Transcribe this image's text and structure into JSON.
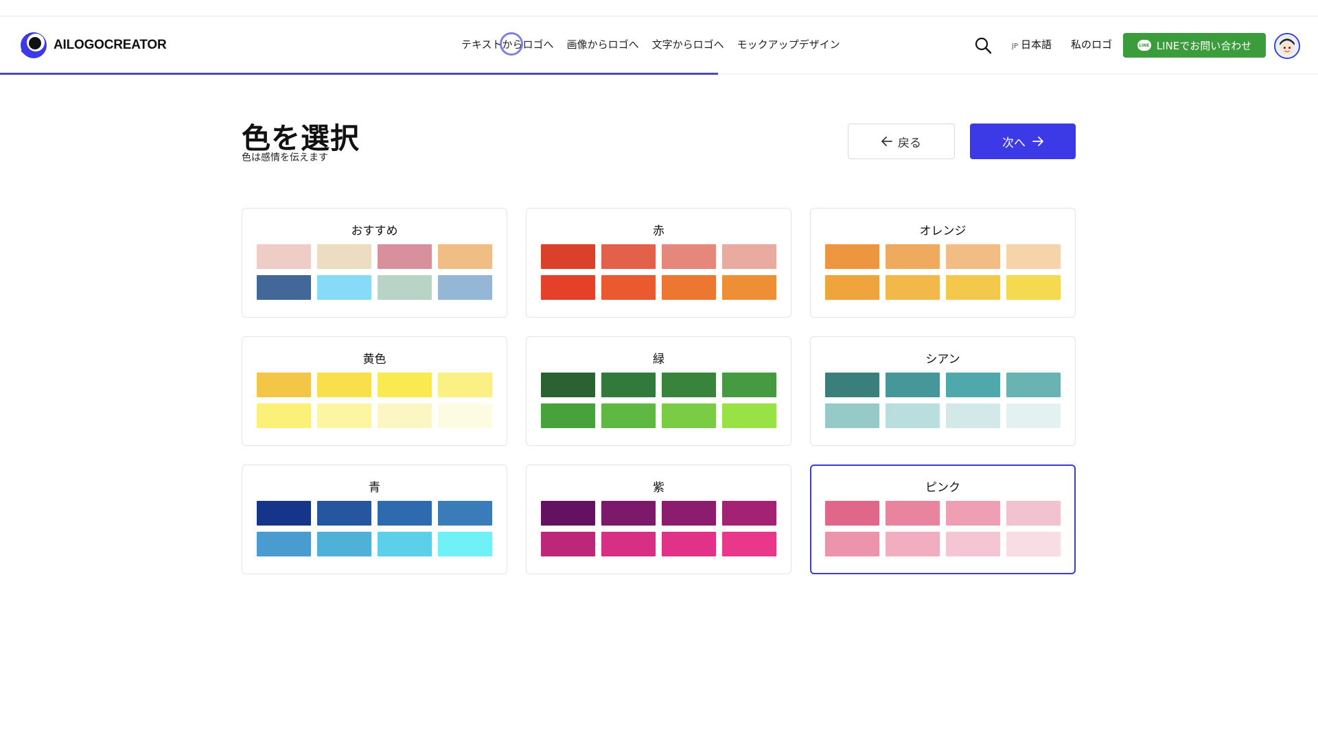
{
  "header": {
    "logo_text": "AILOGOCREATOR",
    "nav": [
      {
        "label": "テキストからロゴへ",
        "name": "nav-text-to-logo"
      },
      {
        "label": "画像からロゴへ",
        "name": "nav-image-to-logo"
      },
      {
        "label": "文字からロゴへ",
        "name": "nav-letter-to-logo"
      },
      {
        "label": "モックアップデザイン",
        "name": "nav-mockup-design"
      }
    ],
    "search_icon": "search-icon",
    "lang_code": "JP",
    "lang_label": "日本語",
    "my_logo": "私のロゴ",
    "line_icon_text": "LINE",
    "line_button": "LINEでお問い合わせ",
    "progress_fraction": 0.545
  },
  "page": {
    "title": "色を選択",
    "subtitle": "色は感情を伝えます",
    "back_label": "戻る",
    "next_label": "次へ"
  },
  "palettes": [
    {
      "label": "おすすめ",
      "selected": false,
      "colors": [
        "#efcdc7",
        "#ecdcc2",
        "#d8909c",
        "#f0bd85",
        "#44679a",
        "#86dcf8",
        "#bad3c7",
        "#95b7d6"
      ]
    },
    {
      "label": "赤",
      "selected": false,
      "colors": [
        "#db412a",
        "#e3604a",
        "#e5877a",
        "#e9ab9f",
        "#e5402a",
        "#eb5a2e",
        "#ed7731",
        "#ee8f35"
      ]
    },
    {
      "label": "オレンジ",
      "selected": false,
      "colors": [
        "#ee953f",
        "#f0aa5f",
        "#f2bd84",
        "#f7d3aa",
        "#f0a53c",
        "#f2b84a",
        "#f4c74d",
        "#f5d950"
      ]
    },
    {
      "label": "黄色",
      "selected": false,
      "colors": [
        "#f4c647",
        "#f8e04d",
        "#f9ea52",
        "#fbf084",
        "#fbf179",
        "#fcf6a3",
        "#fcf7c2",
        "#fdfbe2"
      ]
    },
    {
      "label": "緑",
      "selected": false,
      "colors": [
        "#2b6232",
        "#327a3b",
        "#39843d",
        "#459a42",
        "#48a23c",
        "#5fb842",
        "#7acc44",
        "#98e246"
      ]
    },
    {
      "label": "シアン",
      "selected": false,
      "colors": [
        "#3a7f7c",
        "#46979a",
        "#4fa8ab",
        "#69b4b3",
        "#95cac9",
        "#b9dedd",
        "#d2e8e9",
        "#e3f1f1"
      ]
    },
    {
      "label": "青",
      "selected": false,
      "colors": [
        "#15348a",
        "#2656a0",
        "#2d6aaf",
        "#3a7cb9",
        "#4a9bcf",
        "#4fb0d8",
        "#5ccfea",
        "#6ff1f7"
      ]
    },
    {
      "label": "紫",
      "selected": false,
      "colors": [
        "#631160",
        "#7d196a",
        "#8c1c6d",
        "#a42273",
        "#bc2779",
        "#d62f84",
        "#e23287",
        "#e9388c"
      ]
    },
    {
      "label": "ピンク",
      "selected": true,
      "colors": [
        "#e0668a",
        "#e9849e",
        "#ee9fb4",
        "#f3c2d1",
        "#eb94ac",
        "#f0aec0",
        "#f4c5d3",
        "#f8dde5"
      ]
    }
  ],
  "colors": {
    "accent": "#3c3ae6",
    "line_green": "#3a9c3a",
    "selected_border": "#3c3ad6",
    "progress": "#4a4ab8"
  }
}
